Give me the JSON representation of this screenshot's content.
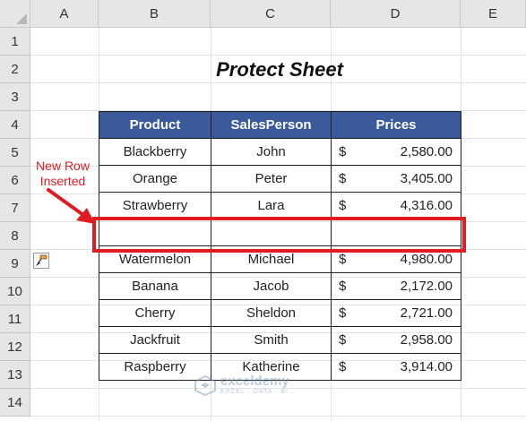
{
  "columns": [
    "A",
    "B",
    "C",
    "D",
    "E"
  ],
  "rows": [
    "1",
    "2",
    "3",
    "4",
    "5",
    "6",
    "7",
    "8",
    "9",
    "10",
    "11",
    "12",
    "13",
    "14"
  ],
  "title": "Protect Sheet",
  "table": {
    "headers": [
      "Product",
      "SalesPerson",
      "Prices"
    ],
    "currency_symbol": "$",
    "rows": [
      {
        "product": "Blackberry",
        "person": "John",
        "price": "2,580.00"
      },
      {
        "product": "Orange",
        "person": "Peter",
        "price": "3,405.00"
      },
      {
        "product": "Strawberry",
        "person": "Lara",
        "price": "4,316.00"
      },
      {
        "product": "",
        "person": "",
        "price": "",
        "inserted": true
      },
      {
        "product": "Watermelon",
        "person": "Michael",
        "price": "4,980.00"
      },
      {
        "product": "Banana",
        "person": "Jacob",
        "price": "2,172.00"
      },
      {
        "product": "Cherry",
        "person": "Sheldon",
        "price": "2,721.00"
      },
      {
        "product": "Jackfruit",
        "person": "Smith",
        "price": "2,958.00"
      },
      {
        "product": "Raspberry",
        "person": "Katherine",
        "price": "3,914.00"
      }
    ]
  },
  "annotation": {
    "line1": "New Row",
    "line2": "Inserted"
  },
  "watermark": {
    "name": "exceldemy",
    "tagline": "EXCEL · DATA · BI"
  },
  "colors": {
    "header_fill": "#3a5a9c",
    "highlight": "#e01b22"
  }
}
